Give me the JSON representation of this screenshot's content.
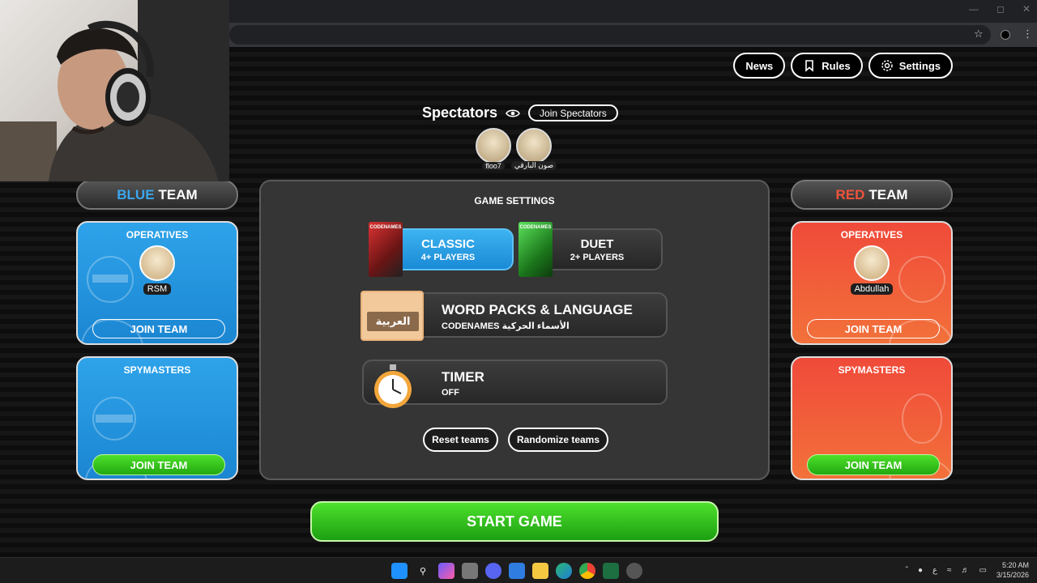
{
  "nav": {
    "news_label": "News",
    "rules_label": "Rules",
    "settings_label": "Settings"
  },
  "spectators": {
    "title": "Spectators",
    "join_label": "Join Spectators",
    "users": [
      "floo7",
      "صون البارقي"
    ]
  },
  "blue_team": {
    "color_word": "BLUE",
    "team_word": "TEAM",
    "operatives_title": "OPERATIVES",
    "operative_player": "RSM",
    "operatives_join": "JOIN TEAM",
    "spymasters_title": "SPYMASTERS",
    "spymasters_join": "JOIN TEAM",
    "color": "#3aa7ee"
  },
  "red_team": {
    "color_word": "RED",
    "team_word": "TEAM",
    "operatives_title": "OPERATIVES",
    "operative_player": "Abdullah",
    "operatives_join": "JOIN TEAM",
    "spymasters_title": "SPYMASTERS",
    "spymasters_join": "JOIN TEAM",
    "color": "#f0533b"
  },
  "game_settings": {
    "title": "GAME SETTINGS",
    "modes": [
      {
        "name": "CLASSIC",
        "players": "4+ PLAYERS",
        "box_label": "CODENAMES",
        "selected": true
      },
      {
        "name": "DUET",
        "players": "2+ PLAYERS",
        "box_label": "CODENAMES",
        "selected": false
      }
    ],
    "word_packs": {
      "title": "WORD PACKS & LANGUAGE",
      "subtitle": "CODENAMES الأسماء الحركية",
      "language_tag": "العربية"
    },
    "timer": {
      "title": "TIMER",
      "value": "OFF"
    },
    "reset_label": "Reset teams",
    "randomize_label": "Randomize teams"
  },
  "start_label": "START GAME",
  "taskbar": {
    "time": "5:20 AM",
    "date": "3/15/2026",
    "lang": "ع"
  }
}
